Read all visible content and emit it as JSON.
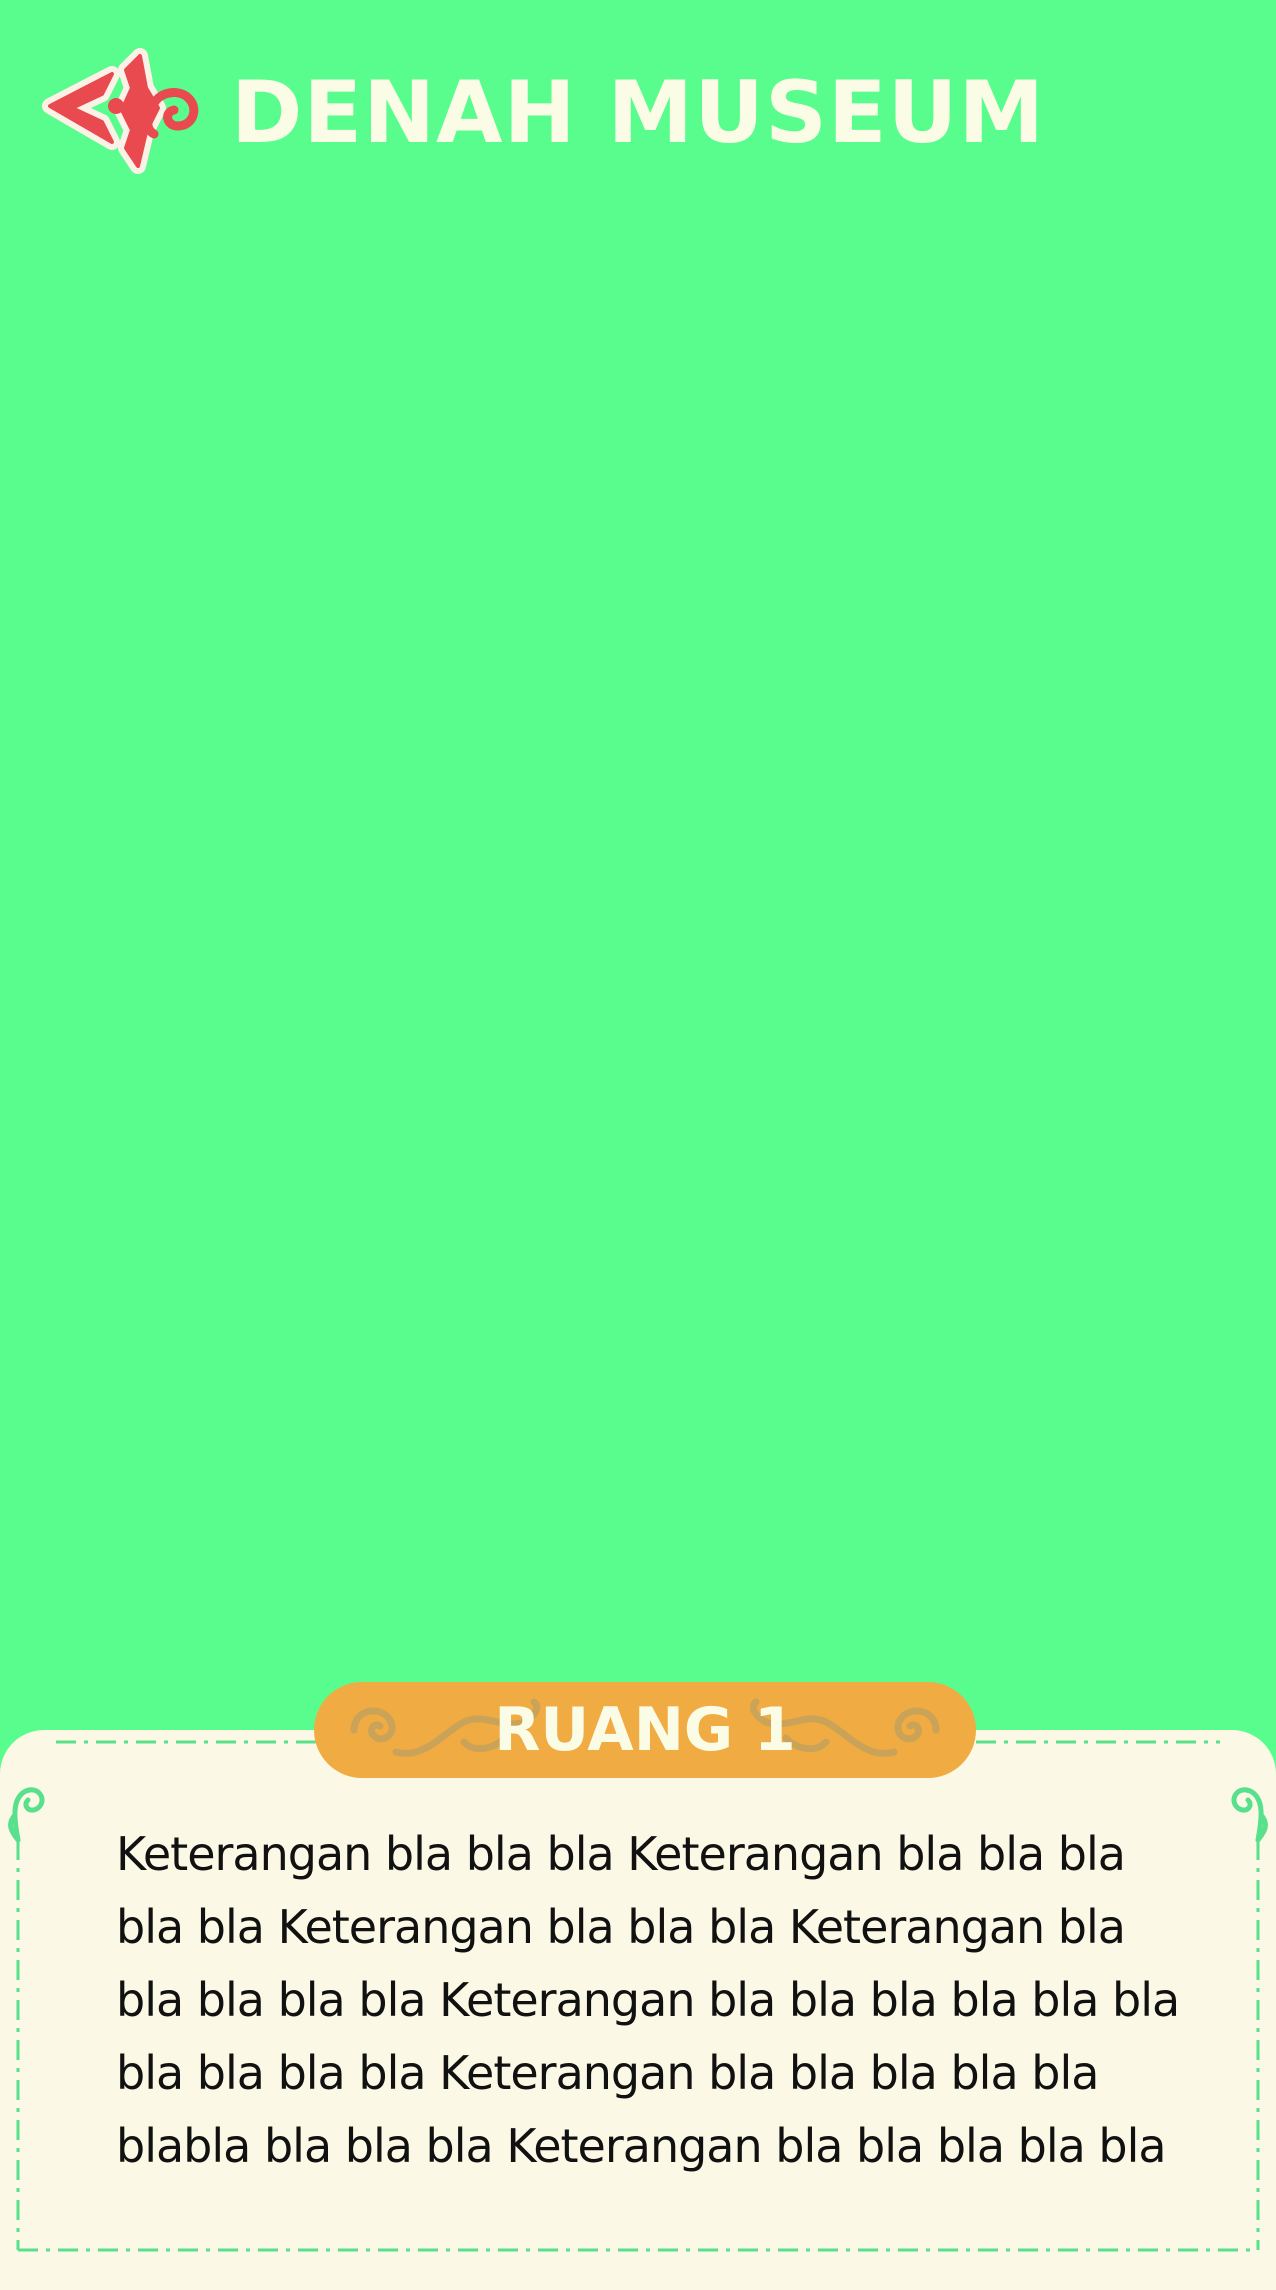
{
  "header": {
    "back_icon": "back-arrow-ornament-icon",
    "title": "DENAH MUSEUM"
  },
  "room_panel": {
    "room_name": "RUANG 1",
    "description": "Keterangan bla bla bla Keterangan bla bla bla\nbla bla  Keterangan bla bla bla Keterangan bla\nbla bla bla bla Keterangan bla bla bla bla bla bla\nbla bla bla bla Keterangan bla bla bla bla bla\nblabla bla bla bla Keterangan bla bla bla bla bla"
  },
  "colors": {
    "background": "#58fd8e",
    "title": "#fbfce6",
    "back_icon": "#e84a4f",
    "panel_background": "#fbf9e5",
    "panel_border": "#58e08c",
    "tab_background": "#f0ac42",
    "tab_ornament": "#c4a25c",
    "description_text": "#111111"
  }
}
